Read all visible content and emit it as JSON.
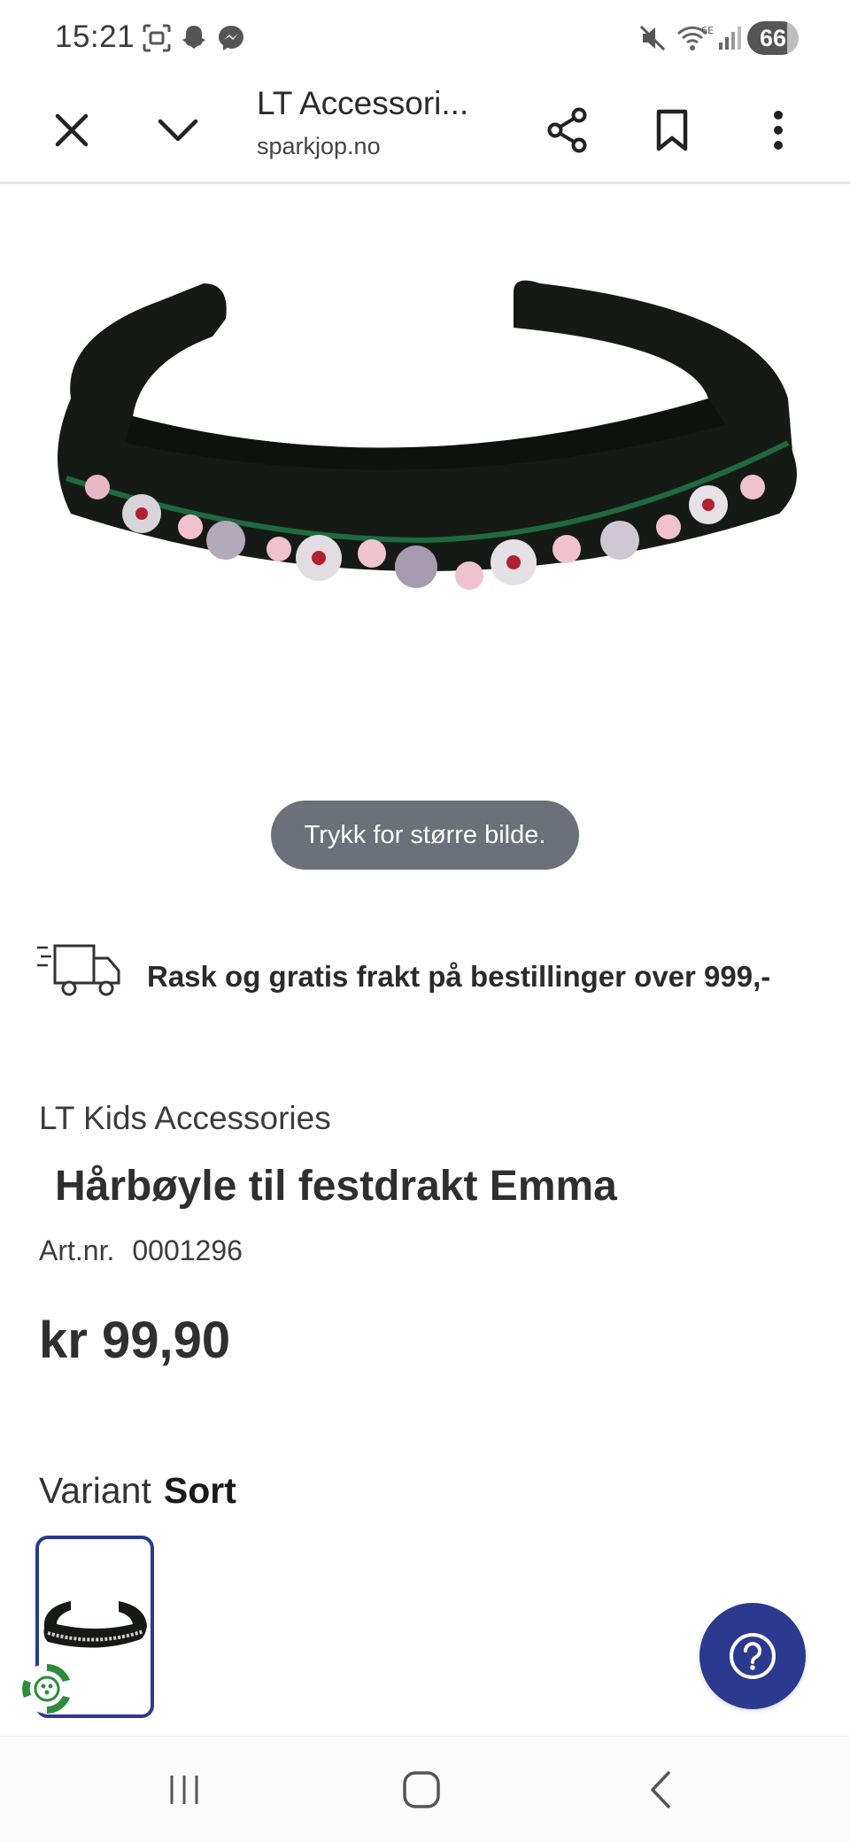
{
  "status_bar": {
    "time": "15:21",
    "battery": "66",
    "icons": [
      "screenshot-icon",
      "snapchat-icon",
      "messenger-icon",
      "mute-icon",
      "wifi-6e-icon",
      "signal-icon"
    ]
  },
  "browser": {
    "tab_title": "LT Accessori...",
    "domain": "sparkjop.no",
    "actions": [
      "close-icon",
      "chevron-down-icon",
      "share-icon",
      "bookmark-icon",
      "more-vert-icon"
    ]
  },
  "product": {
    "zoom_hint": "Trykk for større bilde.",
    "shipping_text": "Rask og gratis frakt på bestillinger over 999,-",
    "brand": "LT Kids Accessories",
    "title": "Hårbøyle til festdrakt Emma",
    "art_label": "Art.nr.",
    "art_number": "0001296",
    "price": "kr 99,90",
    "variant_label": "Variant",
    "variant_value": "Sort"
  },
  "colors": {
    "accent": "#2b3a8f",
    "pill": "#6b7079",
    "eco_green": "#2e8b3a"
  },
  "nav": [
    "recents-icon",
    "home-icon",
    "back-icon"
  ]
}
